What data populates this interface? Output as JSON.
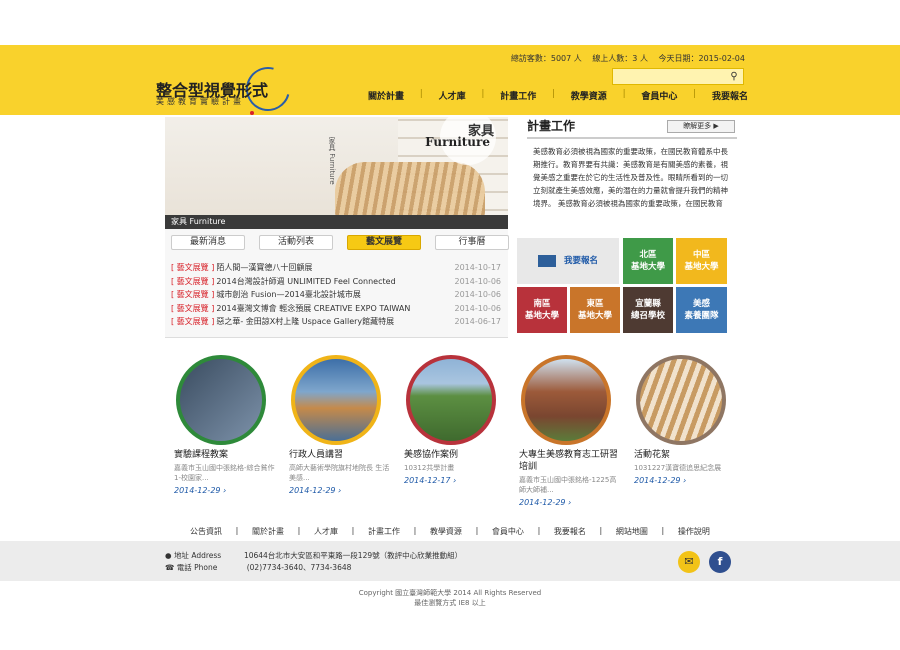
{
  "header": {
    "logo_title": "整合型視覺形式",
    "logo_sub": "美感教育實驗計畫",
    "stats": {
      "visits": "總訪客數：5007 人",
      "online": "線上人數：3 人",
      "today": "今天日期：2015-02-04"
    },
    "search_icon": "search-icon",
    "nav": [
      "關於計畫",
      "人才庫",
      "計畫工作",
      "教學資源",
      "會員中心",
      "我要報名"
    ]
  },
  "banner": {
    "category_zh": "家具",
    "category_en": "Furniture",
    "vertical": "家具 Furniture",
    "caption": "家具 Furniture"
  },
  "tabs": [
    "最新消息",
    "活動列表",
    "藝文展覽",
    "行事曆"
  ],
  "news": [
    {
      "tag": "[ 藝文展覽 ]",
      "title": "陌人間—漢寶德八十回顧展",
      "date": "2014-10-17"
    },
    {
      "tag": "[ 藝文展覽 ]",
      "title": "2014台灣設計師週 UNLIMITED Feel Connected",
      "date": "2014-10-06"
    },
    {
      "tag": "[ 藝文展覽 ]",
      "title": "城市創治 Fusion—2014臺北設計城市展",
      "date": "2014-10-06"
    },
    {
      "tag": "[ 藝文展覽 ]",
      "title": "2014臺灣文博會 輕念預展 CREATIVE EXPO TAIWAN",
      "date": "2014-10-06"
    },
    {
      "tag": "[ 藝文展覽 ]",
      "title": "惡之華- 金田諒X村上隆 Uspace Gallery館藏特展",
      "date": "2014-06-17"
    }
  ],
  "project": {
    "heading": "計畫工作",
    "more": "瞭解更多 ▶",
    "text": "美感教育必須被視為國家的重要政策，在國民教育體系中長期推行。教育界要有共識：美感教育是有關美感的素養，視覺美感之重要在於它的生活性及普及性。眼睛所看到的一切立刻就產生美感效應，美的潛在的力量就會提升我們的精神境界。 美感教育必須被視為國家的重要政策，在國民教育"
  },
  "grid": [
    {
      "label": "我要報名",
      "color": "#e8e8e8",
      "icon": "envelope-icon"
    },
    {
      "label": "北區\n基地大學",
      "color": "#3f9a48"
    },
    {
      "label": "中區\n基地大學",
      "color": "#f2b81d"
    },
    {
      "label": "南區\n基地大學",
      "color": "#b8323b"
    },
    {
      "label": "東區\n基地大學",
      "color": "#c9752a"
    },
    {
      "label": "宜蘭縣\n總召學校",
      "color": "#4e3a32"
    },
    {
      "label": "美感\n素養團隊",
      "color": "#3d78b6"
    }
  ],
  "cards": [
    {
      "title": "實驗課程教案",
      "desc": "嘉義市玉山國中張銘格-綜合貧作1-校園家...",
      "date": "2014-12-29 ›",
      "ring": "#2e8a3a",
      "img": "#5a6f86"
    },
    {
      "title": "行政人員講習",
      "desc": "高師大藝術學院旗村地院長 生活美感...",
      "date": "2014-12-29 ›",
      "ring": "#f0b418",
      "img": "#c58a4a"
    },
    {
      "title": "美感協作案例",
      "desc": "10312共學計畫",
      "date": "2014-12-17 ›",
      "ring": "#b8323b",
      "img": "#4e7d3b"
    },
    {
      "title": "大專生美感教育志工研習培訓",
      "desc": "嘉義市玉山國中張銘格-1225高師大師補...",
      "date": "2014-12-29 ›",
      "ring": "#c9752a",
      "img": "#9c5a3a"
    },
    {
      "title": "活動花絮",
      "desc": "1031227漢寶德追思紀念展",
      "date": "2014-12-29 ›",
      "ring": "#8f7663",
      "img": "#d8b48a"
    }
  ],
  "footnav": [
    "公告資訊",
    "關於計畫",
    "人才庫",
    "計畫工作",
    "教學資源",
    "會員中心",
    "我要報名",
    "網站地圖",
    "操作說明"
  ],
  "footer": {
    "addr_label": "地址 Address",
    "addr": "10644台北市大安區和平東路一段129號（教評中心欣業推動組）",
    "tel_label": "電話 Phone",
    "tel": "(02)7734-3640、7734-3648",
    "mail_icon": "mail-icon",
    "fb_icon": "facebook-icon",
    "copyright": "Copyright 國立臺灣師範大學 2014 All Rights Reserved",
    "browser": "最佳瀏覽方式 IE8 以上"
  }
}
